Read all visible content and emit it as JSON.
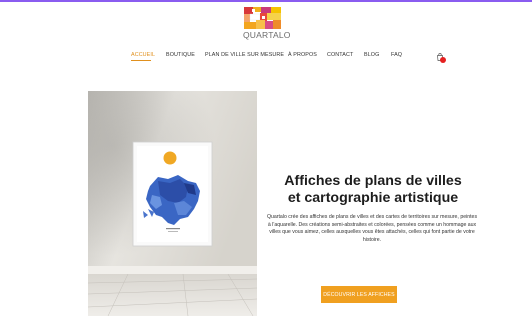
{
  "brand": {
    "logo_text": "QUARTALO",
    "accent": "#e0901e",
    "top_bar_color": "#8a5cf0"
  },
  "nav": {
    "items": [
      {
        "label": "ACCUEIL",
        "active": true
      },
      {
        "label": "BOUTIQUE",
        "active": false
      },
      {
        "label": "PLAN DE VILLE SUR MESURE",
        "active": false
      },
      {
        "label": "À PROPOS",
        "active": false
      },
      {
        "label": "CONTACT",
        "active": false
      },
      {
        "label": "BLOG",
        "active": false
      },
      {
        "label": "FAQ",
        "active": false
      }
    ],
    "cart_icon": "shopping-bag-icon",
    "cart_badge_color": "#e52020"
  },
  "hero": {
    "headline_line1": "Affiches de plans de villes",
    "headline_line2": "et cartographie artistique",
    "body": "Quartalo crée des affiches de plans de villes et des cartes de territoires sur mesure, peintes à l'aquarelle. Des créations semi-abstraites et colorées, pensées comme un hommage aux villes que vous aimez, celles auxquelles vous êtes attachés, celles qui font partie de votre histoire.",
    "cta_label": "DÉCOUVRIR LES AFFICHES",
    "cta_color": "#f0a020"
  }
}
